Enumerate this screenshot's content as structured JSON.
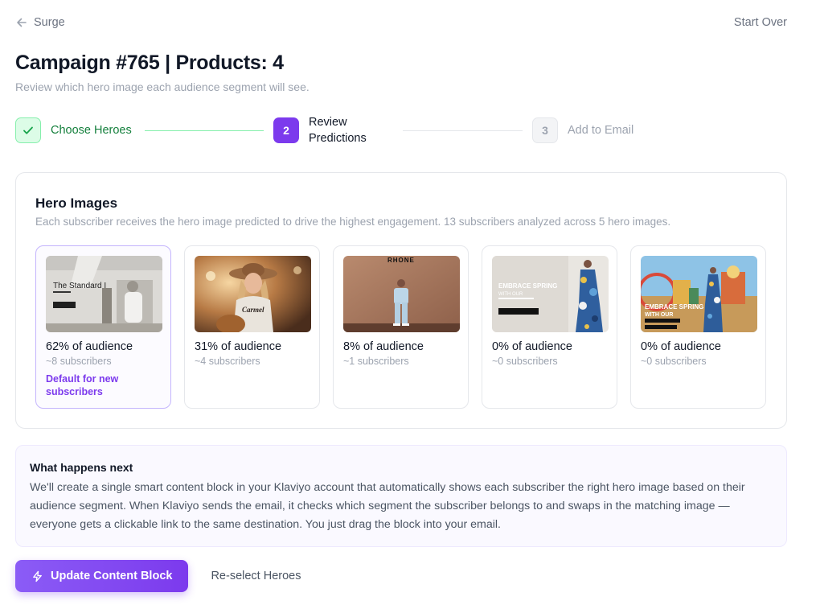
{
  "nav": {
    "back_label": "Surge",
    "start_over_label": "Start Over"
  },
  "header": {
    "title": "Campaign #765 | Products: 4",
    "subtitle": "Review which hero image each audience segment will see."
  },
  "stepper": {
    "steps": [
      {
        "number": "1",
        "label": "Choose Heroes",
        "state": "complete"
      },
      {
        "number": "2",
        "label_line1": "Review",
        "label_line2": "Predictions",
        "state": "active"
      },
      {
        "number": "3",
        "label": "Add to Email",
        "state": "upcoming"
      }
    ]
  },
  "hero_images": {
    "title": "Hero Images",
    "description": "Each subscriber receives the hero image predicted to drive the highest engagement. 13 subscribers analyzed across 5 hero images.",
    "cards": [
      {
        "percent": "62% of audience",
        "subscribers": "~8 subscribers",
        "tag": "Default for new subscribers",
        "thumb_text": "The Standard I"
      },
      {
        "percent": "31% of audience",
        "subscribers": "~4 subscribers",
        "thumb_text": "Carmel"
      },
      {
        "percent": "8% of audience",
        "subscribers": "~1 subscribers",
        "thumb_text": "RHONE"
      },
      {
        "percent": "0% of audience",
        "subscribers": "~0 subscribers",
        "thumb_text": "EMBRACE SPRING",
        "thumb_sub": "WITH OUR"
      },
      {
        "percent": "0% of audience",
        "subscribers": "~0 subscribers",
        "thumb_text": "EMBRACE SPRING",
        "thumb_sub": "WITH OUR"
      }
    ]
  },
  "next": {
    "title": "What happens next",
    "body": "We'll create a single smart content block in your Klaviyo account that automatically shows each subscriber the right hero image based on their audience segment. When Klaviyo sends the email, it checks which segment the subscriber belongs to and swaps in the matching image — everyone gets a clickable link to the same destination. You just drag the block into your email."
  },
  "actions": {
    "primary_label": "Update Content Block",
    "secondary_label": "Re-select Heroes"
  },
  "colors": {
    "accent": "#7c3aed",
    "success": "#16a34a",
    "muted": "#9ca3af"
  }
}
